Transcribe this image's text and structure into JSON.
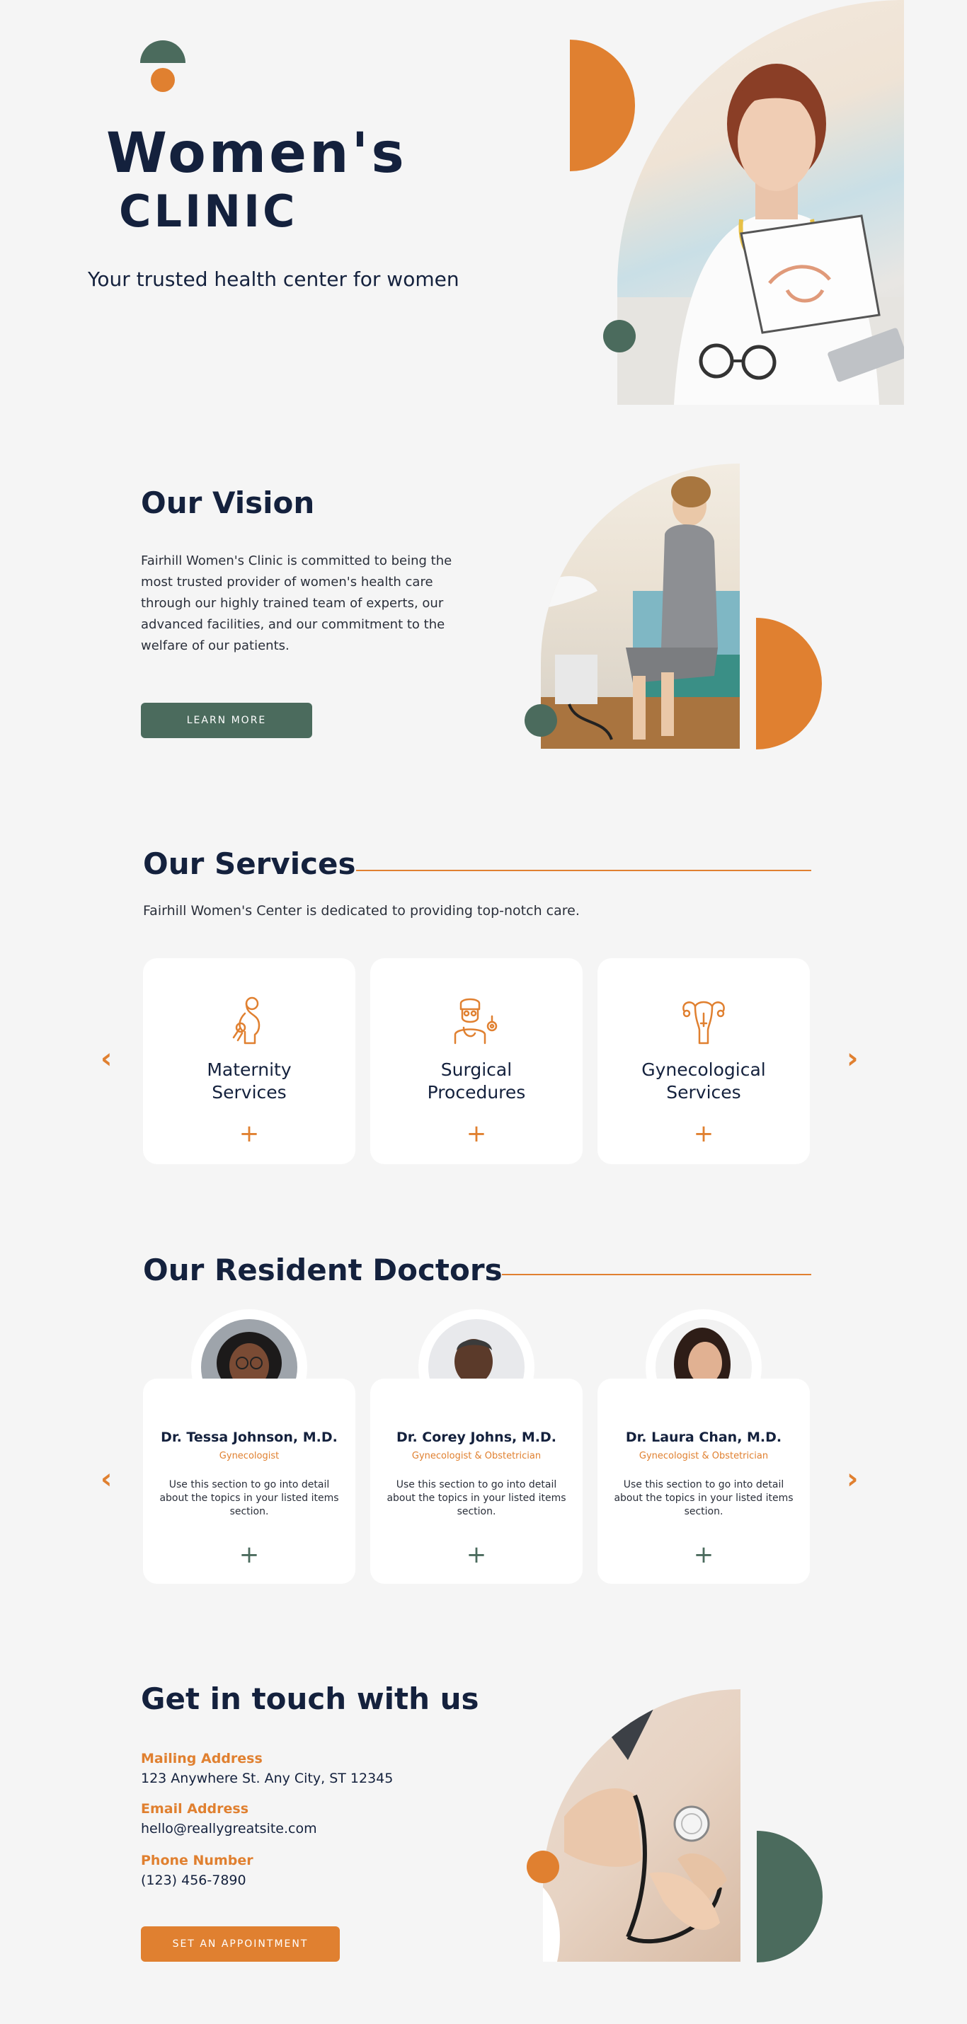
{
  "hero": {
    "title": "Women's",
    "subtitle": "CLINIC",
    "tagline": "Your trusted health center for women"
  },
  "vision": {
    "heading": "Our Vision",
    "body": "Fairhill Women's Clinic is committed to being the most trusted provider of women's health care through our highly trained team of experts, our advanced facilities, and our commitment to the welfare of our patients.",
    "button": "LEARN MORE"
  },
  "services": {
    "heading": "Our Services",
    "intro": "Fairhill Women's Center is dedicated to providing top-notch care.",
    "items": [
      {
        "name": "Maternity Services",
        "icon": "pregnant-woman-icon",
        "plus": "+"
      },
      {
        "name": "Surgical Procedures",
        "icon": "surgeon-icon",
        "plus": "+"
      },
      {
        "name": "Gynecological Services",
        "icon": "uterus-icon",
        "plus": "+"
      }
    ],
    "prev_arrow": "‹",
    "next_arrow": "›"
  },
  "doctors": {
    "heading": "Our Resident Doctors",
    "items": [
      {
        "name": "Dr. Tessa Johnson, M.D.",
        "role": "Gynecologist",
        "desc": "Use this section to go into detail about the topics in your listed items section.",
        "plus": "+"
      },
      {
        "name": "Dr. Corey Johns, M.D.",
        "role": "Gynecologist & Obstetrician",
        "desc": "Use this section to go into detail about the topics in your listed items section.",
        "plus": "+"
      },
      {
        "name": "Dr. Laura Chan, M.D.",
        "role": "Gynecologist & Obstetrician",
        "desc": "Use this section to go into detail about the topics in your listed items section.",
        "plus": "+"
      }
    ],
    "prev_arrow": "‹",
    "next_arrow": "›"
  },
  "contact": {
    "heading": "Get in touch with us",
    "mailing_label": "Mailing Address",
    "mailing_value": "123 Anywhere St. Any City, ST 12345",
    "email_label": "Email Address",
    "email_value": "hello@reallygreatsite.com",
    "phone_label": "Phone Number",
    "phone_value": "(123) 456-7890",
    "button": "SET AN APPOINTMENT"
  },
  "colors": {
    "navy": "#14213d",
    "orange": "#e08030",
    "green": "#4b6b5d",
    "background": "#f5f5f5"
  }
}
